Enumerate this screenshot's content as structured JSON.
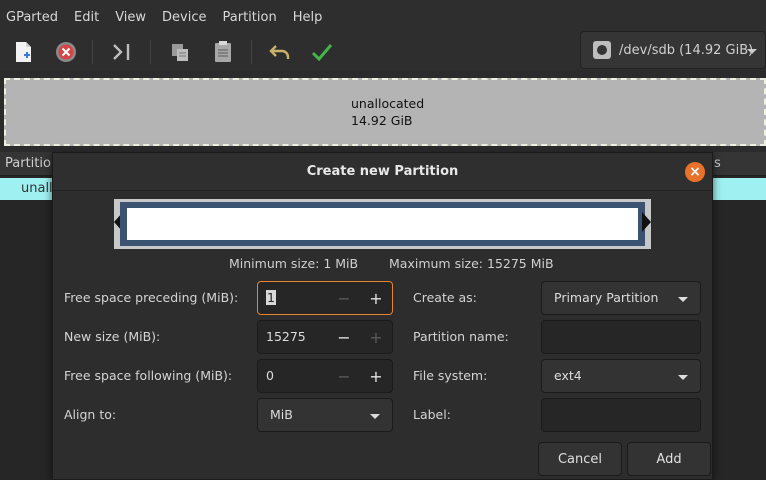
{
  "menubar": {
    "items": [
      "GParted",
      "Edit",
      "View",
      "Device",
      "Partition",
      "Help"
    ]
  },
  "toolbar": {
    "buttons": [
      "new-icon",
      "delete-icon",
      "resize-move-icon",
      "copy-icon",
      "paste-icon",
      "undo-icon",
      "apply-icon"
    ],
    "device": "/dev/sdb (14.92 GiB)"
  },
  "graph": {
    "label": "unallocated",
    "size": "14.92 GiB"
  },
  "list": {
    "header_partition": "Partitio",
    "header_flags": "s",
    "row_partition": "unall"
  },
  "dialog": {
    "title": "Create new Partition",
    "min_size": "Minimum size: 1 MiB",
    "max_size": "Maximum size: 15275 MiB",
    "free_preceding_label": "Free space preceding (MiB):",
    "free_preceding_value": "1",
    "new_size_label": "New size (MiB):",
    "new_size_value": "15275",
    "free_following_label": "Free space following (MiB):",
    "free_following_value": "0",
    "align_label": "Align to:",
    "align_value": "MiB",
    "create_as_label": "Create as:",
    "create_as_value": "Primary Partition",
    "partition_name_label": "Partition name:",
    "partition_name_value": "",
    "file_system_label": "File system:",
    "file_system_value": "ext4",
    "label_label": "Label:",
    "label_value": "",
    "cancel_label": "Cancel",
    "add_label": "Add",
    "close_glyph": "×",
    "minus_glyph": "−",
    "plus_glyph": "+"
  },
  "colors": {
    "accent": "#e8832e",
    "selection_row": "#9ff1f1",
    "partition_border": "#3b5371",
    "apply_green": "#44b34a"
  }
}
